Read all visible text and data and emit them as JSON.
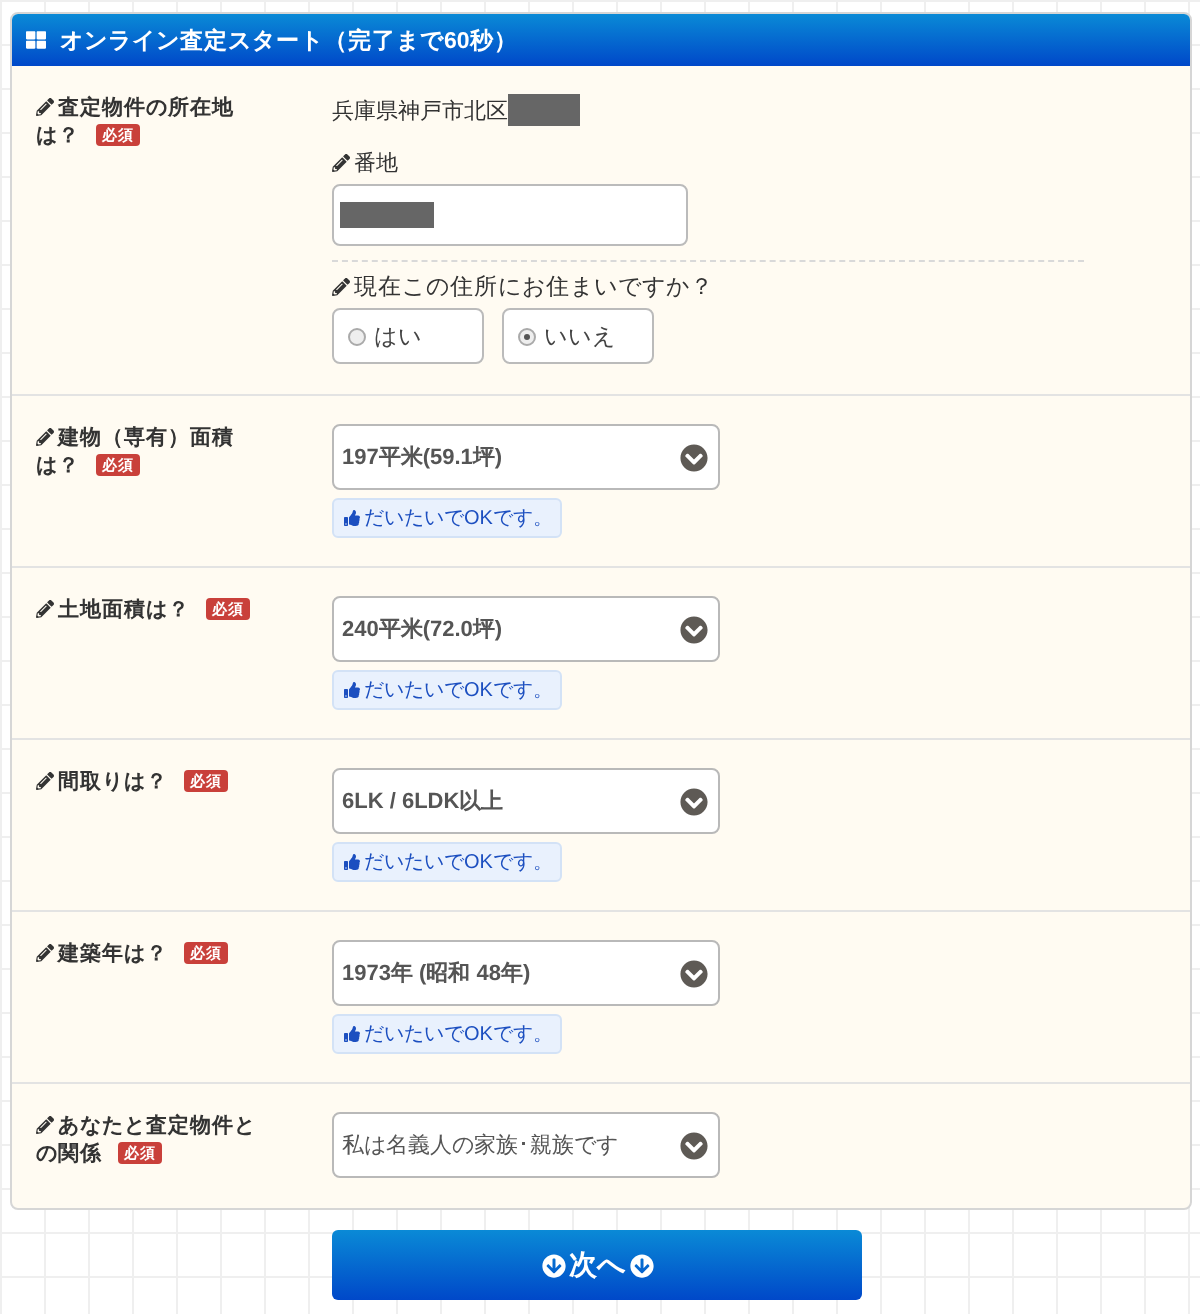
{
  "panel": {
    "title": "オンライン査定スタート（完了まで60秒）"
  },
  "rows": [
    {
      "kind": "address",
      "label": "査定物件の所在地は？",
      "badge": "必須",
      "address": "兵庫県神戸市北区",
      "address_redacted": true,
      "lot": {
        "label": "番地",
        "redacted": true
      },
      "residence": {
        "question": "現在この住所にお住まいですか？",
        "options": [
          {
            "label": "はい",
            "selected": false
          },
          {
            "label": "いいえ",
            "selected": true
          }
        ]
      }
    },
    {
      "kind": "select",
      "label": "建物（専有）面積は？",
      "badge": "必須",
      "value": "197平米(59.1坪)",
      "hint": "だいたいでOKです。"
    },
    {
      "kind": "select",
      "label": "土地面積は？",
      "badge": "必須",
      "value": "240平米(72.0坪)",
      "hint": "だいたいでOKです。"
    },
    {
      "kind": "select",
      "label": "間取りは？",
      "badge": "必須",
      "value": "6LK / 6LDK以上",
      "hint": "だいたいでOKです。"
    },
    {
      "kind": "select",
      "label": "建築年は？",
      "badge": "必須",
      "value": "1973年 (昭和 48年)",
      "hint": "だいたいでOKです。"
    },
    {
      "kind": "select",
      "label": "あなたと査定物件との関係",
      "badge": "必須",
      "value": "私は名義人の家族･親族です",
      "plain": true
    }
  ],
  "next_button": {
    "label": "次へ"
  }
}
